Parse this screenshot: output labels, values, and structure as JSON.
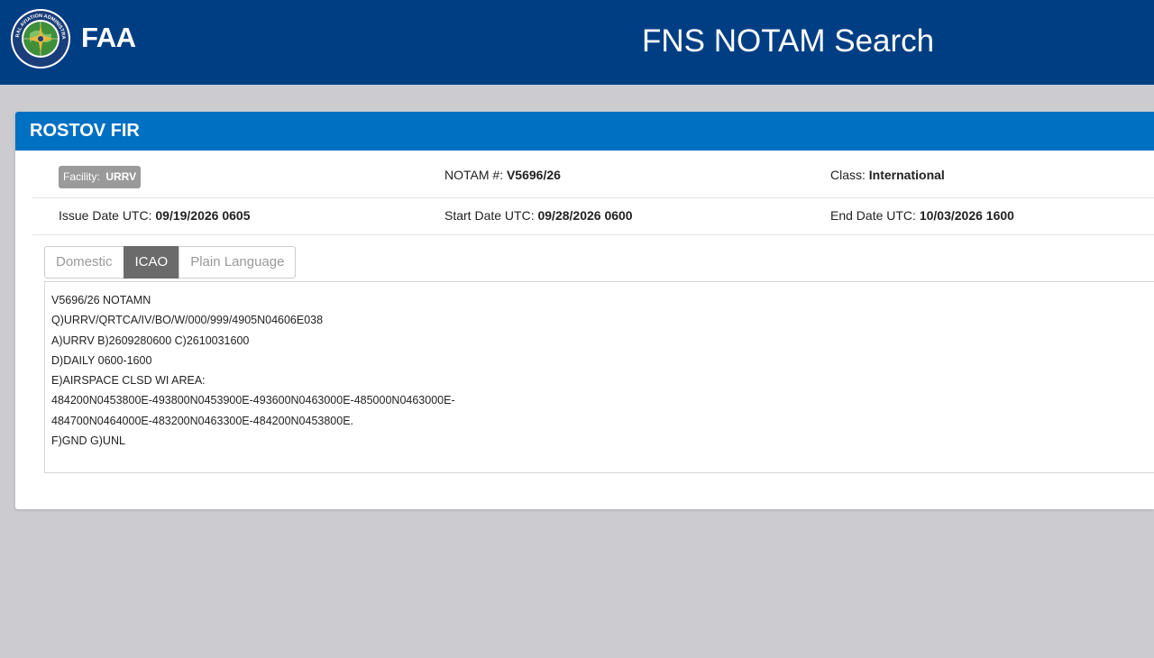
{
  "header": {
    "brand": "FAA",
    "app_title": "FNS NOTAM Search",
    "seal_text": "FEDERAL AVIATION ADMINISTRATION"
  },
  "card": {
    "title": "ROSTOV FIR",
    "facility": {
      "label": "Facility:",
      "value": "URRV"
    },
    "notam_number": {
      "label": "NOTAM #:",
      "value": "V5696/26"
    },
    "class": {
      "label": "Class:",
      "value": "International"
    },
    "issue_date": {
      "label": "Issue Date UTC:",
      "value": "09/19/2026 0605"
    },
    "start_date": {
      "label": "Start Date UTC:",
      "value": "09/28/2026 0600"
    },
    "end_date": {
      "label": "End Date UTC:",
      "value": "10/03/2026 1600"
    }
  },
  "tabs": [
    {
      "label": "Domestic",
      "active": false
    },
    {
      "label": "ICAO",
      "active": true
    },
    {
      "label": "Plain Language",
      "active": false
    }
  ],
  "notam_text": [
    "V5696/26 NOTAMN",
    "Q)URRV/QRTCA/IV/BO/W/000/999/4905N04606E038",
    "A)URRV B)2609280600 C)2610031600",
    "D)DAILY 0600-1600",
    "E)AIRSPACE CLSD WI AREA:",
    "484200N0453800E-493800N0453900E-493600N0463000E-485000N0463000E-",
    "484700N0464000E-483200N0463300E-484200N0453800E.",
    "F)GND  G)UNL"
  ],
  "colors": {
    "header_bg": "#003e83",
    "card_header_bg": "#0070c2",
    "page_bg": "#cbcbd0",
    "active_tab_bg": "#6b6b6b"
  }
}
